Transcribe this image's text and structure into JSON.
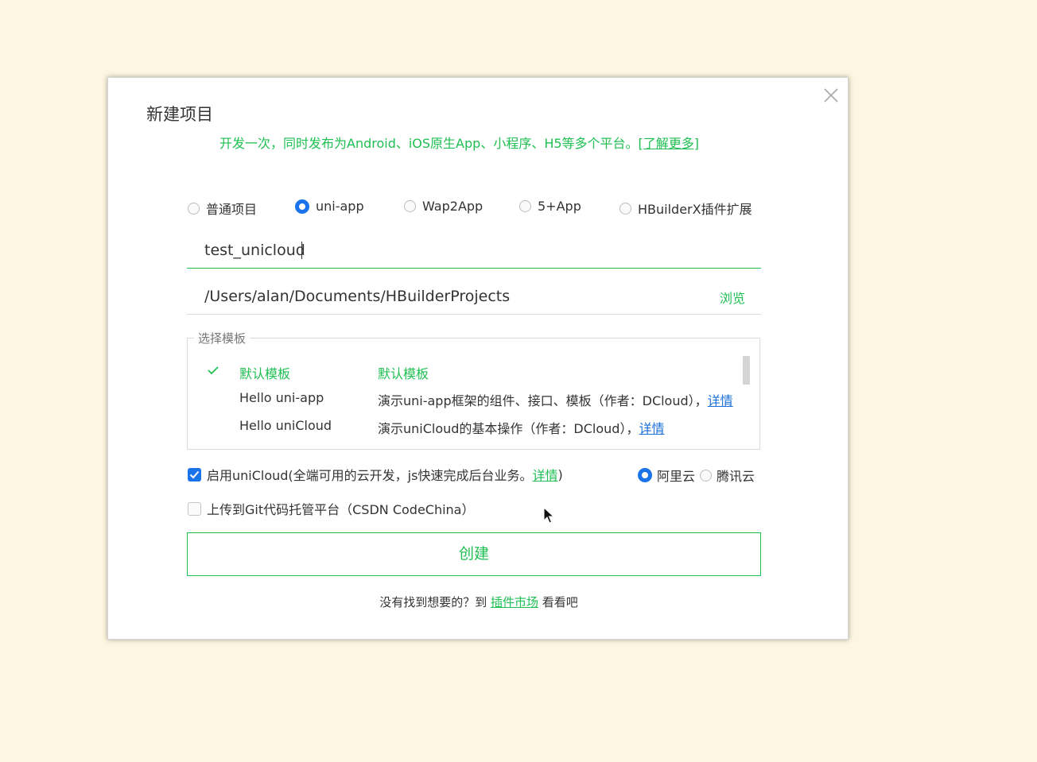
{
  "dialog": {
    "title": "新建项目",
    "subtitle_text": "开发一次，同时发布为Android、iOS原生App、小程序、H5等多个平台。",
    "subtitle_link": "[了解更多]",
    "close_icon": "close-icon"
  },
  "project_types": [
    {
      "label": "普通项目",
      "selected": false
    },
    {
      "label": "uni-app",
      "selected": true
    },
    {
      "label": "Wap2App",
      "selected": false
    },
    {
      "label": "5+App",
      "selected": false
    },
    {
      "label": "HBuilderX插件扩展",
      "selected": false
    }
  ],
  "project_name": {
    "value": "test_unicloud"
  },
  "project_path": {
    "value": "/Users/alan/Documents/HBuilderProjects",
    "browse_label": "浏览"
  },
  "templates": {
    "legend": "选择模板",
    "rows": [
      {
        "name": "默认模板",
        "desc": "默认模板",
        "link": "",
        "selected": true
      },
      {
        "name": "Hello uni-app",
        "desc": "演示uni-app框架的组件、接口、模板（作者：DCloud），",
        "link": "详情",
        "selected": false
      },
      {
        "name": "Hello uniCloud",
        "desc": "演示uniCloud的基本操作（作者：DCloud），",
        "link": "详情",
        "selected": false
      }
    ]
  },
  "unicloud": {
    "checked": true,
    "label_prefix": "启用uniCloud(全端可用的云开发，js快速完成后台业务。",
    "label_link": "详情",
    "label_suffix": ")",
    "providers": [
      {
        "label": "阿里云",
        "selected": true
      },
      {
        "label": "腾讯云",
        "selected": false
      }
    ]
  },
  "git_upload": {
    "checked": false,
    "label": "上传到Git代码托管平台（CSDN CodeChina）"
  },
  "create_button": "创建",
  "footer": {
    "prefix": "没有找到想要的？到 ",
    "link": "插件市场",
    "suffix": " 看看吧"
  },
  "colors": {
    "accent_green": "#1fbf52",
    "radio_blue": "#1a73e8",
    "link_blue": "#1a6fd8",
    "backdrop": "#fdf7e1"
  }
}
